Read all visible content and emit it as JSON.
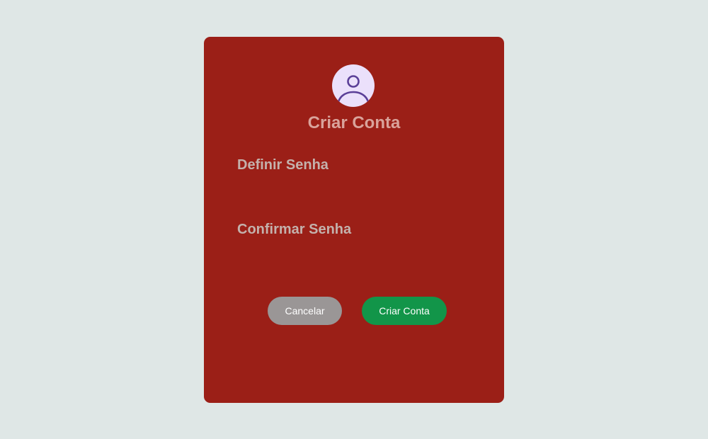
{
  "dialog": {
    "title": "Criar Conta",
    "avatar_icon": "user-icon",
    "password_label": "Definir Senha",
    "password_value": "",
    "confirm_label": "Confirmar Senha",
    "confirm_value": "",
    "cancel_button": "Cancelar",
    "create_button": "Criar Conta"
  },
  "colors": {
    "background": "#dfe7e6",
    "card": "#9b1f17",
    "avatar_bg": "#ebe0fb",
    "avatar_stroke": "#5b3f98",
    "title_text": "#d9a39b",
    "label_text": "#c4b1ac",
    "cancel_bg": "#9a9696",
    "create_bg": "#129549"
  }
}
